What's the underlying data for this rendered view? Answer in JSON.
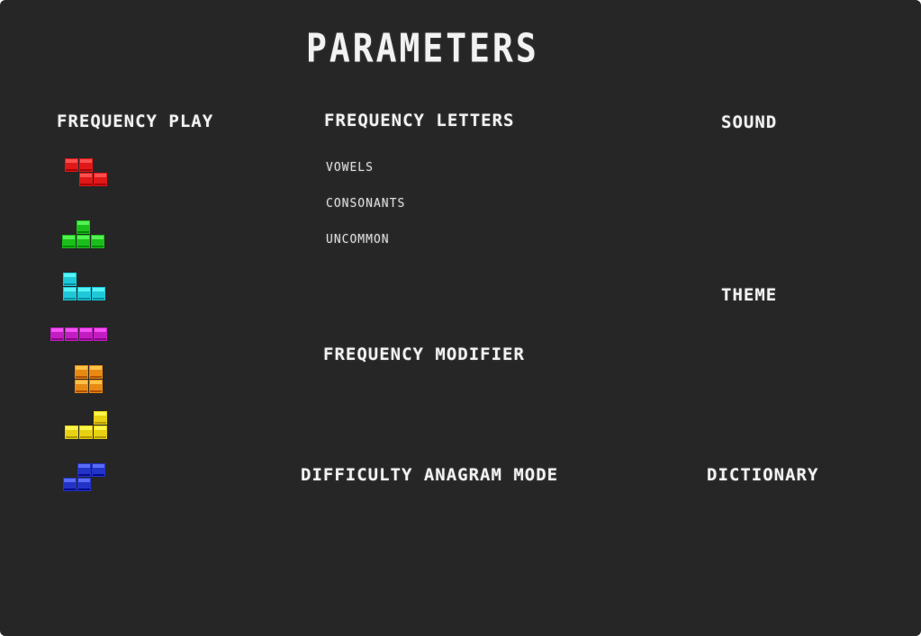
{
  "title": "PARAMETERS",
  "sections": {
    "frequency_play": "FREQUENCY PLAY",
    "frequency_letters": "FREQUENCY LETTERS",
    "sound": "SOUND",
    "theme": "THEME",
    "frequency_modifier": "FREQUENCY MODIFIER",
    "difficulty_anagram_mode": "DIFFICULTY ANAGRAM MODE",
    "dictionary": "DICTIONARY"
  },
  "letters": {
    "vowels": "VOWELS",
    "consonants": "CONSONANTS",
    "uncommon": "UNCOMMON"
  },
  "pieces": [
    {
      "name": "z-piece-icon",
      "color": "#e01818"
    },
    {
      "name": "t-piece-icon",
      "color": "#1bbf1b"
    },
    {
      "name": "j-piece-icon",
      "color": "#1ec8d8"
    },
    {
      "name": "i-piece-icon",
      "color": "#c21cc2"
    },
    {
      "name": "o-piece-icon",
      "color": "#e88a12"
    },
    {
      "name": "l-piece-icon",
      "color": "#e8d012"
    },
    {
      "name": "s-piece-icon",
      "color": "#2233c8"
    }
  ]
}
